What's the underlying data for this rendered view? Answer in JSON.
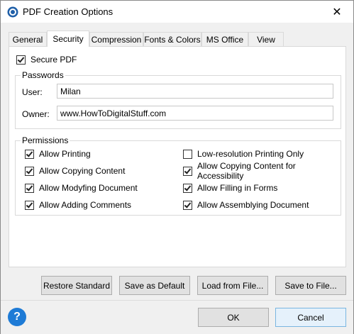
{
  "window": {
    "title": "PDF Creation Options",
    "close_glyph": "✕"
  },
  "tabs": [
    {
      "label": "General"
    },
    {
      "label": "Security",
      "active": true
    },
    {
      "label": "Compression"
    },
    {
      "label": "Fonts & Colors"
    },
    {
      "label": "MS Office"
    },
    {
      "label": "View"
    }
  ],
  "security": {
    "secure_pdf": {
      "label": "Secure PDF",
      "checked": true
    },
    "passwords": {
      "group_label": "Passwords",
      "user_label": "User:",
      "user_value": "Milan",
      "owner_label": "Owner:",
      "owner_value": "www.HowToDigitalStuff.com"
    },
    "permissions": {
      "group_label": "Permissions",
      "items": [
        {
          "label": "Allow Printing",
          "checked": true
        },
        {
          "label": "Allow Copying Content",
          "checked": true
        },
        {
          "label": "Allow Modyfing Document",
          "checked": true
        },
        {
          "label": "Allow Adding Comments",
          "checked": true
        },
        {
          "label": "Low-resolution Printing Only",
          "checked": false
        },
        {
          "label": "Allow Copying Content for Accessibility",
          "checked": true
        },
        {
          "label": "Allow Filling in Forms",
          "checked": true
        },
        {
          "label": "Allow Assemblying Document",
          "checked": true
        }
      ]
    }
  },
  "buttons": {
    "restore": "Restore Standard",
    "save_default": "Save as Default",
    "load_file": "Load from File...",
    "save_file": "Save to File...",
    "ok": "OK",
    "cancel": "Cancel"
  },
  "footer": {
    "help_glyph": "?"
  },
  "colors": {
    "help_icon": "#1e7bd6",
    "default_button_border": "#7ab6e0"
  }
}
